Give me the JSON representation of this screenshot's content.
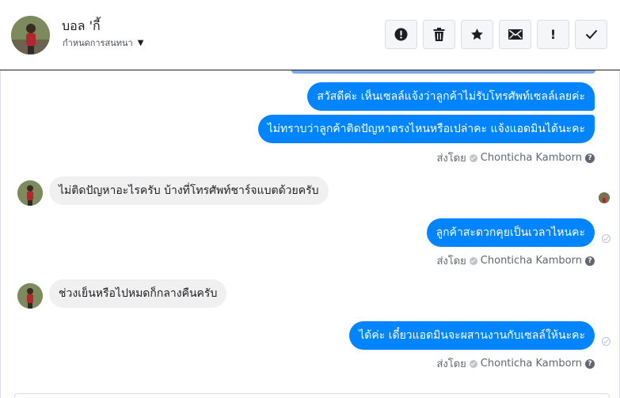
{
  "contact": {
    "name": "บอล 'กี้",
    "subtitle": "กำหนดการสนทนา"
  },
  "header_actions": [
    {
      "name": "report-button",
      "icon": "alert-circle-icon"
    },
    {
      "name": "delete-button",
      "icon": "trash-icon"
    },
    {
      "name": "star-button",
      "icon": "star-icon"
    },
    {
      "name": "mark-unread-button",
      "icon": "envelope-icon"
    },
    {
      "name": "important-button",
      "icon": "exclamation-icon",
      "glyph": "!"
    },
    {
      "name": "mark-done-button",
      "icon": "checkmark-icon"
    }
  ],
  "messages": [
    {
      "direction": "out",
      "text": "สวัสดีค่ะ เห็นเซลล์แจ้งว่าลูกค้าไม่รับโทรศัพท์เซลล์เลยค่ะ"
    },
    {
      "direction": "out",
      "text": "ไม่ทราบว่าลูกค้าติดปัญหาตรงไหนหรือเปล่าคะ แจ้งแอดมินได้นะคะ"
    },
    {
      "direction": "in",
      "text": "ไม่ติดปัญหาอะไรครับ บ้างที่โทรศัพท์ชาร์จแบตด้วยครับ"
    },
    {
      "direction": "out",
      "text": "ลูกค้าสะดวกคุยเป็นเวลาไหนคะ"
    },
    {
      "direction": "in",
      "text": "ช่วงเย็นหรือไปหมดก็กลางคืนครับ"
    },
    {
      "direction": "out",
      "text": "ได้ค่ะ เดี๋ยวแอดมินจะผสานงานกับเซลล์ให้นะคะ"
    }
  ],
  "sent_by": {
    "prefix": "ส่งโดย",
    "agent": "Chonticha Kamborn",
    "help": "?"
  },
  "colors": {
    "outgoing_bubble": "#0084ff",
    "incoming_bubble": "#f1f0f0"
  }
}
